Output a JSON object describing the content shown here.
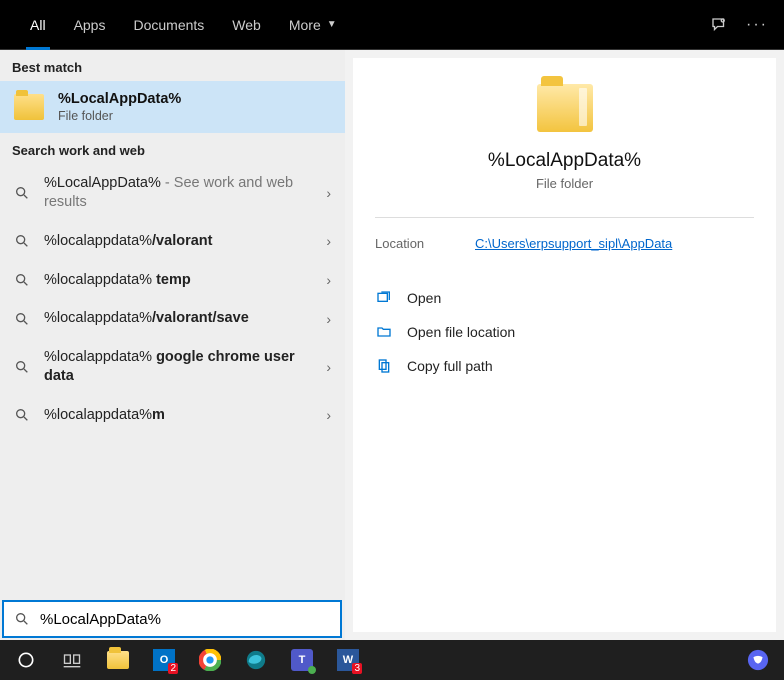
{
  "tabs": {
    "all": "All",
    "apps": "Apps",
    "documents": "Documents",
    "web": "Web",
    "more": "More"
  },
  "sections": {
    "best_match": "Best match",
    "search_web": "Search work and web"
  },
  "best_match": {
    "title": "%LocalAppData%",
    "subtitle": "File folder"
  },
  "suggestions": [
    {
      "prefix": "%LocalAppData%",
      "bold": "",
      "hint": " - See work and web results"
    },
    {
      "prefix": "%localappdata%",
      "bold": "/valorant",
      "hint": ""
    },
    {
      "prefix": "%localappdata% ",
      "bold": "temp",
      "hint": ""
    },
    {
      "prefix": "%localappdata%",
      "bold": "/valorant/save",
      "hint": ""
    },
    {
      "prefix": "%localappdata% ",
      "bold": "google chrome user data",
      "hint": ""
    },
    {
      "prefix": "%localappdata%",
      "bold": "m",
      "hint": ""
    }
  ],
  "details": {
    "title": "%LocalAppData%",
    "subtitle": "File folder",
    "location_label": "Location",
    "location_value": "C:\\Users\\erpsupport_sipl\\AppData"
  },
  "actions": {
    "open": "Open",
    "open_location": "Open file location",
    "copy_path": "Copy full path"
  },
  "search_input": "%LocalAppData%"
}
